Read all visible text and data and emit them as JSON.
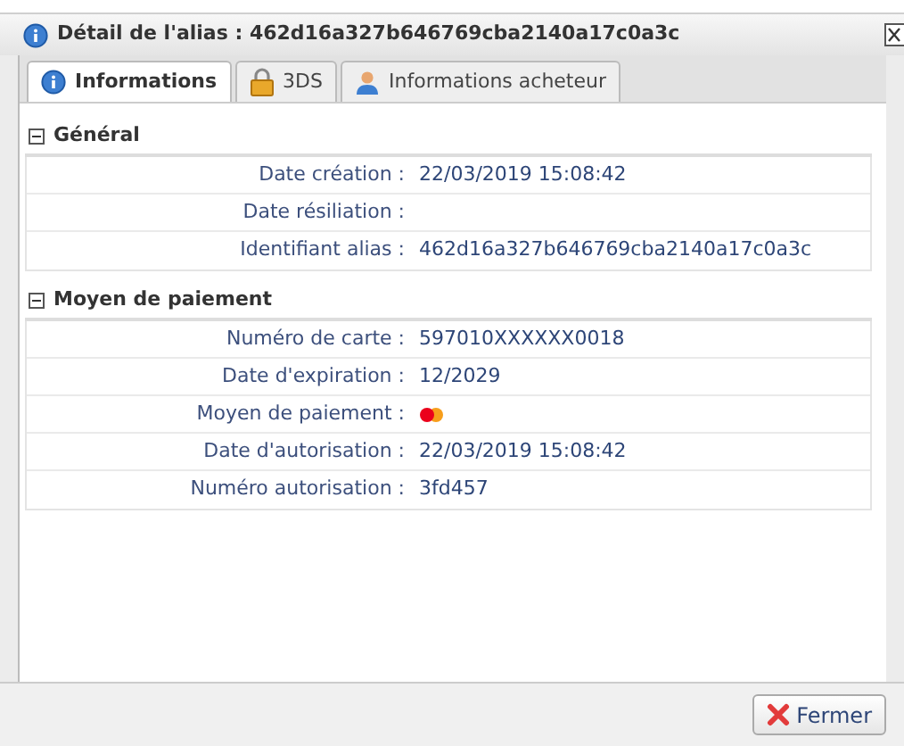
{
  "window": {
    "title": "Détail de l'alias : 462d16a327b646769cba2140a17c0a3c"
  },
  "tabs": [
    {
      "label": "Informations",
      "kind": "info",
      "selected": true
    },
    {
      "label": "3DS",
      "kind": "lock",
      "selected": false
    },
    {
      "label": "Informations acheteur",
      "kind": "person",
      "selected": false
    }
  ],
  "sections": [
    {
      "title": "Général",
      "expanded": true,
      "rows": [
        {
          "label": "Date création :",
          "kind": "text",
          "value": "22/03/2019 15:08:42"
        },
        {
          "label": "Date résiliation :",
          "kind": "text"
        },
        {
          "label": "Identifiant alias :",
          "kind": "text",
          "value": "462d16a327b646769cba2140a17c0a3c"
        }
      ]
    },
    {
      "title": "Moyen de paiement",
      "expanded": true,
      "rows": [
        {
          "label": "Numéro de carte :",
          "kind": "text",
          "value": "597010XXXXXX0018"
        },
        {
          "label": "Date d'expiration :",
          "kind": "text",
          "value": "12/2029"
        },
        {
          "label": "Moyen de paiement :",
          "kind": "card"
        },
        {
          "label": "Date d'autorisation :",
          "kind": "text",
          "value": "22/03/2019 15:08:42"
        },
        {
          "label": "Numéro autorisation :",
          "kind": "text",
          "value": "3fd457"
        }
      ]
    }
  ],
  "buttons": [
    {
      "label": "Fermer"
    }
  ]
}
